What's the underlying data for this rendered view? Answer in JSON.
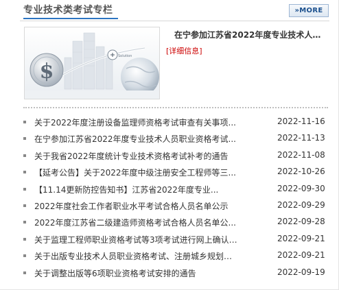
{
  "section": {
    "title": "专业技术类考试专栏",
    "more_label": "MORE",
    "more_icon": "double-chevron-right-icon"
  },
  "featured": {
    "title": "在宁参加江苏省2022年度专业技术人...",
    "detail_link": "[详细信息]",
    "image_caption": "Solution"
  },
  "colors": {
    "accent_blue": "#2b74c2",
    "link_red": "#cc0000"
  },
  "news": [
    {
      "title": "关于2022年度注册设备监理师资格考试审查有关事项...",
      "date": "2022-11-16"
    },
    {
      "title": "在宁参加江苏省2022年度专业技术人员职业资格考试...",
      "date": "2022-11-13"
    },
    {
      "title": "关于我省2022年度统计专业技术资格考试补考的通告",
      "date": "2022-11-08"
    },
    {
      "title": "【延考公告】关于2022年度中级注册安全工程师等三...",
      "date": "2022-10-26"
    },
    {
      "title": "【11.14更新防控告知书】江苏省2022年度专业...",
      "date": "2022-09-30"
    },
    {
      "title": "2022年度社会工作者职业水平考试合格人员名单公示",
      "date": "2022-09-29"
    },
    {
      "title": "2022年度江苏省二级建造师资格考试合格人员名单公...",
      "date": "2022-09-28"
    },
    {
      "title": "关于监理工程师职业资格考试等3项考试进行网上确认的...",
      "date": "2022-09-21"
    },
    {
      "title": "关于出版专业技术人员职业资格考试、注册城乡规划师职...",
      "date": "2022-09-21"
    },
    {
      "title": "关于调整出版等6项职业资格考试安排的通告",
      "date": "2022-09-19"
    }
  ]
}
